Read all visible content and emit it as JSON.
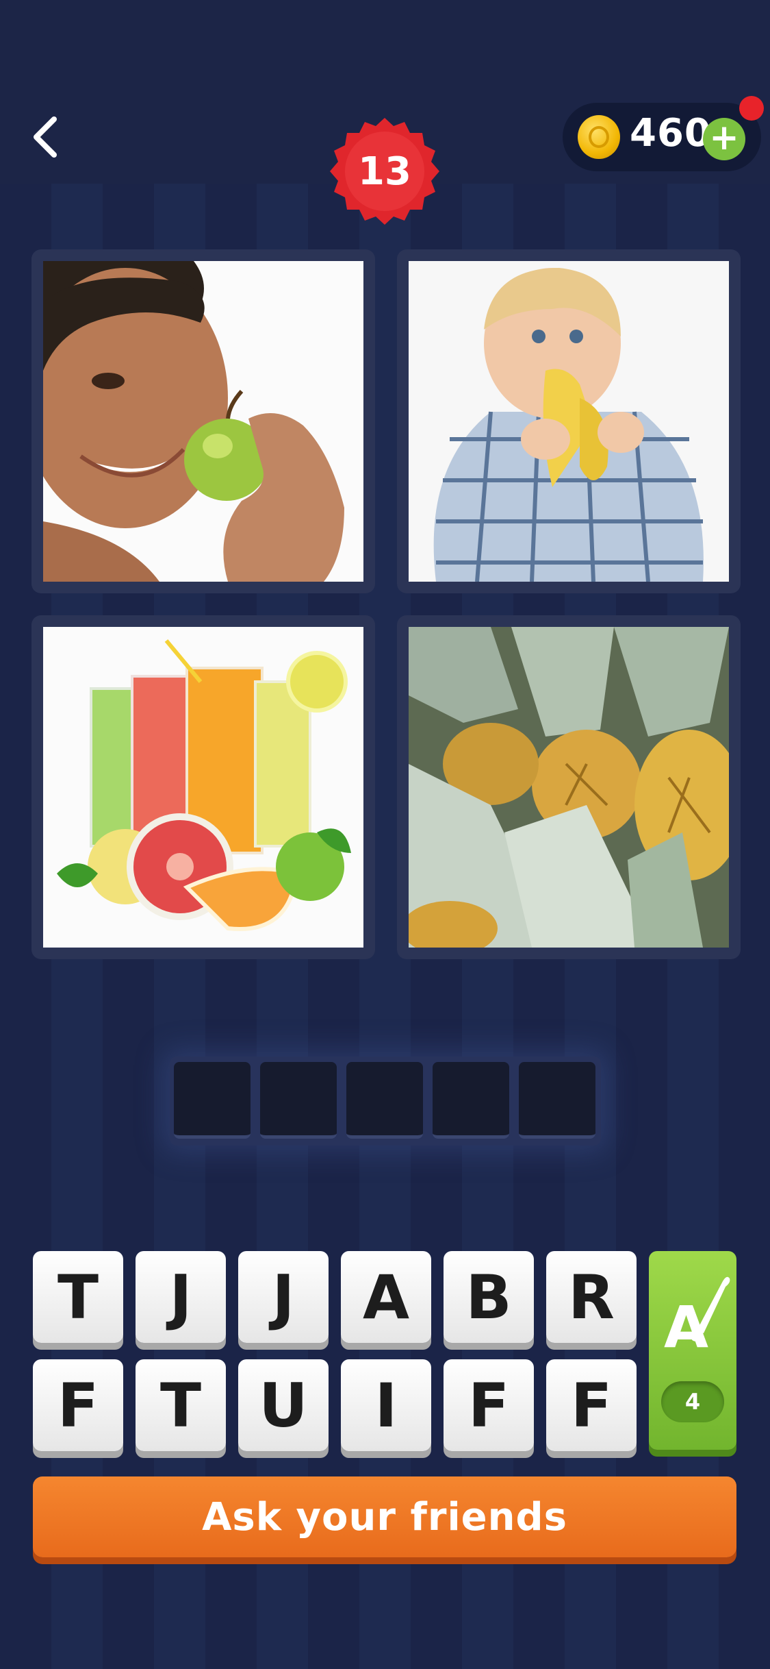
{
  "header": {
    "back_icon": "chevron-left-icon",
    "level": "13",
    "coins": "460",
    "add_coins_icon": "plus-icon",
    "colors": {
      "badge": "#e0262c",
      "coin": "#f2b705",
      "plus": "#7cc240",
      "notif": "#e8232a"
    }
  },
  "puzzle": {
    "images": [
      {
        "subject": "woman holding green apple"
      },
      {
        "subject": "toddler eating banana"
      },
      {
        "subject": "glasses of fruit juice with citrus"
      },
      {
        "subject": "pineapples"
      }
    ],
    "answer_slots": [
      "",
      "",
      "",
      "",
      ""
    ]
  },
  "keyboard": {
    "row1": [
      "T",
      "J",
      "J",
      "A",
      "B",
      "R"
    ],
    "row2": [
      "F",
      "T",
      "U",
      "I",
      "F",
      "F"
    ],
    "hint_icon": "paintbrush-letter-icon",
    "hint_count": "4"
  },
  "footer": {
    "ask_label": "Ask your friends",
    "colors": {
      "button": "#f5862f",
      "hint": "#8ccc3c",
      "background": "#1b2448"
    }
  }
}
